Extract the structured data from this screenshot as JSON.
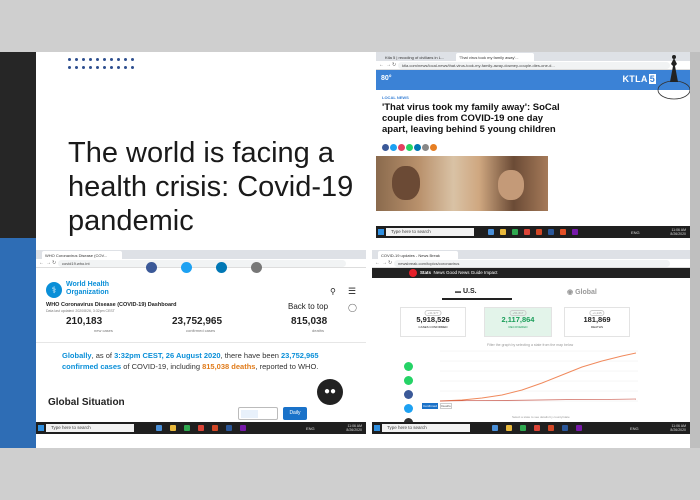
{
  "slide": {
    "title": "The world is facing a health crisis: Covid-19 pandemic"
  },
  "ktla": {
    "tabs": [
      "Ktla 5 | recoding of civilians in L...",
      "'That virus took my family away'..."
    ],
    "url": "ktla.com/news/local-news/that-virus-took-my-family-away-downey-couple-dies-one-d...",
    "temp": "80°",
    "logo": "KTLA",
    "logo_num": "5",
    "category": "LOCAL NEWS",
    "headline": "'That virus took my family away': SoCal couple dies from COVID-19 one day apart, leaving behind 5 young children",
    "taskbar_search": "Type here to search",
    "clock": "11:06 AM\n8/26/2020",
    "lang": "ENG",
    "accent": "#3b82d6"
  },
  "who": {
    "tab": "WHO Coronavirus Disease (COV...",
    "url": "covid19.who.int",
    "org_line1": "World Health",
    "org_line2": "Organization",
    "dashboard_title": "WHO Coronavirus Disease (COVID-19) Dashboard",
    "last_updated": "Data last updated: 2020/8/26, 3:32pm CEST",
    "back_to_top": "Back to top",
    "stats": [
      {
        "value": "210,183",
        "label": "new cases"
      },
      {
        "value": "23,752,965",
        "label": "confirmed cases"
      },
      {
        "value": "815,038",
        "label": "deaths"
      }
    ],
    "globally": {
      "p1": "Globally",
      "p2": ", as of ",
      "p3": "3:32pm CEST, 26 August 2020",
      "p4": ", there have been ",
      "p5": "23,752,965",
      "p6": "confirmed cases",
      "p7": " of COVID-19, including ",
      "p8": "815,038 deaths",
      "p9": ", reported to WHO."
    },
    "global_situation": "Global Situation",
    "daily": "Daily",
    "taskbar_search": "Type here to search",
    "clock": "11:06 AM\n8/26/2020",
    "lang": "ENG"
  },
  "newsbreak": {
    "tab": "COVID-19 updates - News Break",
    "url": "newsbreak.com/topics/coronavirus",
    "brand": "Stats",
    "nav": "News   Good News   Guide   Impact",
    "us_label": "U.S.",
    "global_label": "Global",
    "cards": [
      {
        "tag": "+41,977",
        "value": "5,918,526",
        "label": "CASES CONFIRMED",
        "color": "#222222",
        "bg": "#ffffff"
      },
      {
        "tag": "+51,617",
        "value": "2,117,864",
        "label": "RECOVERED",
        "color": "#1b9e5a",
        "bg": "#e3f4ea"
      },
      {
        "tag": "+1,245",
        "value": "181,869",
        "label": "DEATHS",
        "color": "#222222",
        "bg": "#ffffff"
      }
    ],
    "chart_hint": "Filter the graph by selecting a state from the map below",
    "legend": [
      "Confirmed",
      "Deaths"
    ],
    "state_hint": "Select a state to see details by county/state",
    "taskbar_search": "Type here to search",
    "clock": "11:06 AM\n8/26/2020",
    "lang": "ENG"
  }
}
